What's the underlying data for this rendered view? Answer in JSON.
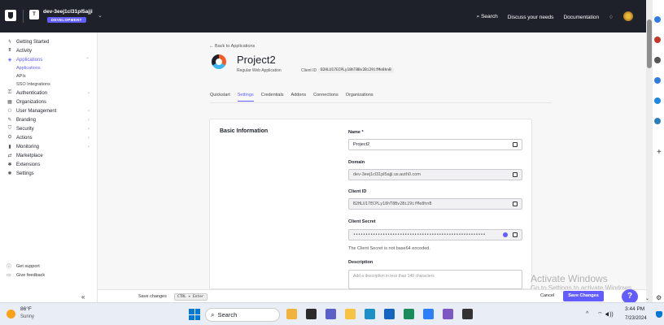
{
  "topbar": {
    "tenant_badge": "T",
    "tenant_name": "dev-3eej1cl31pl5ajji",
    "tenant_env": "DEVELOPMENT",
    "search_label": "Search",
    "discuss_label": "Discuss your needs",
    "docs_label": "Documentation"
  },
  "sidebar": {
    "items": [
      {
        "label": "Getting Started",
        "icon": "bolt-icon"
      },
      {
        "label": "Activity",
        "icon": "activity-icon"
      },
      {
        "label": "Applications",
        "icon": "layers-icon"
      },
      {
        "label": "Authentication",
        "icon": "key-icon"
      },
      {
        "label": "Organizations",
        "icon": "building-icon"
      },
      {
        "label": "User Management",
        "icon": "users-icon"
      },
      {
        "label": "Branding",
        "icon": "brush-icon"
      },
      {
        "label": "Security",
        "icon": "shield-icon"
      },
      {
        "label": "Actions",
        "icon": "actions-icon"
      },
      {
        "label": "Monitoring",
        "icon": "chart-icon"
      },
      {
        "label": "Marketplace",
        "icon": "store-icon"
      },
      {
        "label": "Extensions",
        "icon": "puzzle-icon"
      },
      {
        "label": "Settings",
        "icon": "gear-icon"
      }
    ],
    "sub_items": [
      "Applications",
      "APIs",
      "SSO Integrations"
    ],
    "get_support": "Get support",
    "give_feedback": "Give feedback",
    "collapse": "«"
  },
  "header": {
    "back_link": "← Back to Applications",
    "app_title": "Project2",
    "app_type": "Regular Web Application",
    "client_id_label": "Client ID",
    "client_id": "B2HLU17ECPLy18hT8Bv2Bi29ifMe8hnB"
  },
  "tabs": [
    "Quickstart",
    "Settings",
    "Credentials",
    "Addons",
    "Connections",
    "Organizations"
  ],
  "form": {
    "section_title": "Basic Information",
    "name_label": "Name *",
    "name_value": "Project2",
    "domain_label": "Domain",
    "domain_value": "dev-3eej1cl31pl5ajji.us.auth0.com",
    "client_id_label": "Client ID",
    "client_id_value": "B2HLU17ECPLy18hT8Bv2Bi29ifMe8hnB",
    "secret_label": "Client Secret",
    "secret_value": "••••••••••••••••••••••••••••••••••••••••••••••••••••••",
    "secret_help": "The Client Secret is not base64 encoded.",
    "description_label": "Description",
    "description_placeholder": "Add a description in less than 140 characters"
  },
  "footer": {
    "save_hint": "Save changes",
    "kbd": "CTRL + Enter",
    "cancel": "Cancel",
    "save": "Save Changes",
    "help": "?"
  },
  "watermark": {
    "line1": "Activate Windows",
    "line2": "Go to Settings to activate Windows."
  },
  "taskbar": {
    "temp": "86°F",
    "weather_desc": "Sunny",
    "search": "Search",
    "time": "3:44 PM",
    "date": "7/23/2024"
  }
}
